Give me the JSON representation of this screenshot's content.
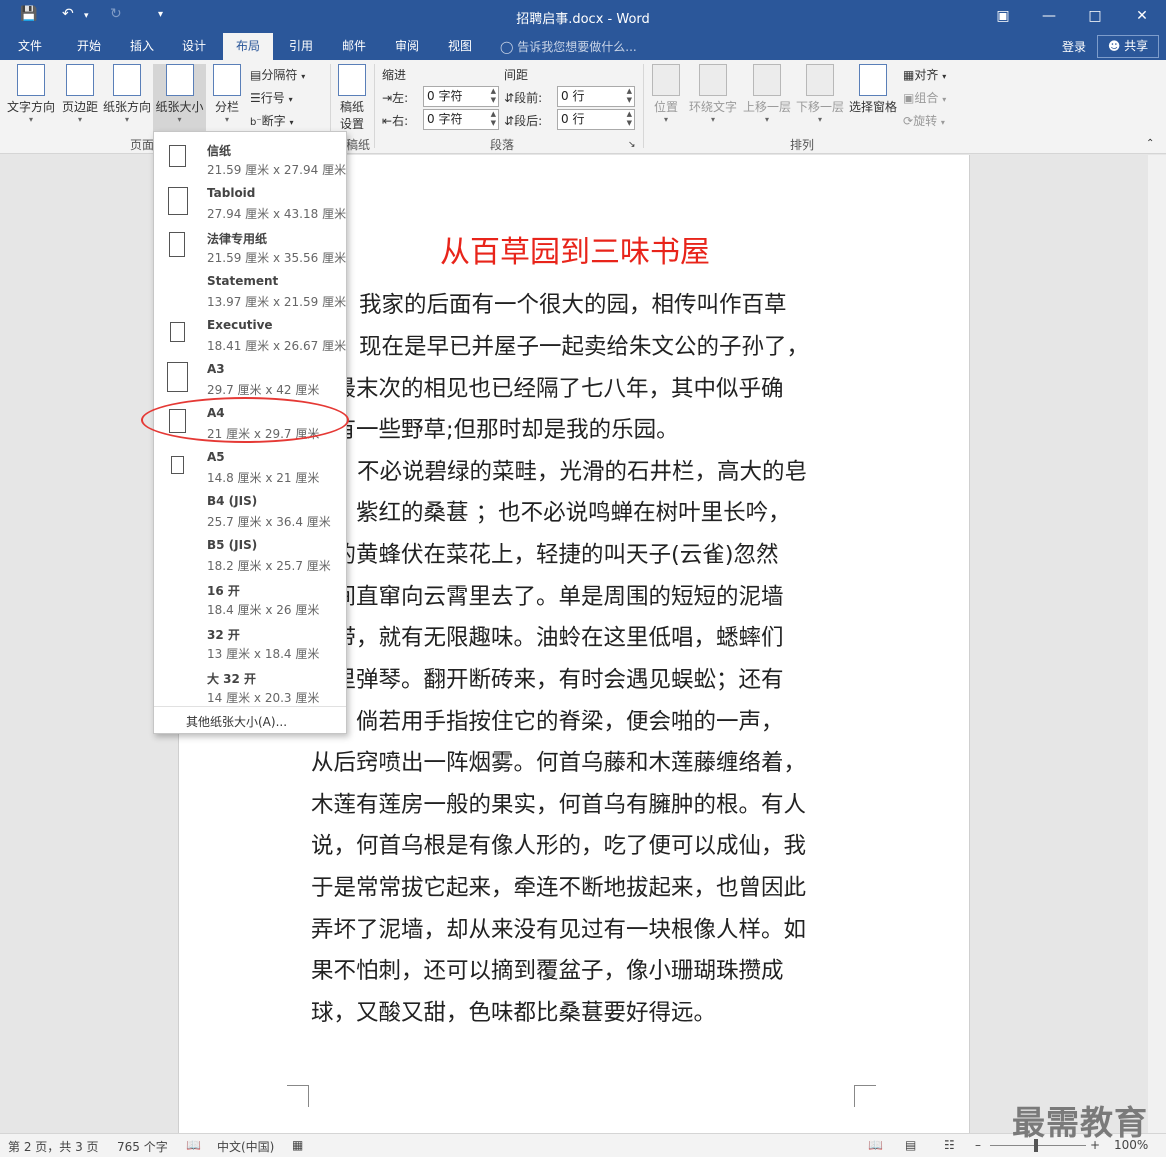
{
  "window": {
    "title": "招聘启事.docx - Word",
    "save_icon": "save-icon",
    "undo_icon": "undo-icon",
    "redo_icon": "redo-icon"
  },
  "tabs": [
    "文件",
    "开始",
    "插入",
    "设计",
    "布局",
    "引用",
    "邮件",
    "审阅",
    "视图"
  ],
  "active_tab": "布局",
  "tell_me": "告诉我您想要做什么...",
  "login": "登录",
  "share": "共享",
  "ribbon": {
    "page_setup": {
      "text_direction": "文字方向",
      "margins": "页边距",
      "orientation": "纸张方向",
      "size": "纸张大小",
      "columns": "分栏",
      "breaks": "分隔符",
      "line_numbers": "行号",
      "hyphenation": "断字",
      "group_label": "页面"
    },
    "draft": {
      "label_line1": "稿纸",
      "label_line2": "设置",
      "group_label": "稿纸"
    },
    "indent": {
      "title": "缩进",
      "left_label": "左:",
      "left_value": "0 字符",
      "right_label": "右:",
      "right_value": "0 字符"
    },
    "spacing": {
      "title": "间距",
      "before_label": "段前:",
      "before_value": "0 行",
      "after_label": "段后:",
      "after_value": "0 行"
    },
    "paragraph_group": "段落",
    "arrange": {
      "position": "位置",
      "wrap": "环绕文字",
      "forward": "上移一层",
      "backward": "下移一层",
      "selection_pane": "选择窗格",
      "align": "对齐",
      "group": "组合",
      "rotate": "旋转",
      "group_label": "排列"
    }
  },
  "paper_sizes": [
    {
      "name": "信纸",
      "dims": "21.59 厘米 x 27.94 厘米"
    },
    {
      "name": "Tabloid",
      "dims": "27.94 厘米 x 43.18 厘米"
    },
    {
      "name": "法律专用纸",
      "dims": "21.59 厘米 x 35.56 厘米"
    },
    {
      "name": "Statement",
      "dims": "13.97 厘米 x 21.59 厘米"
    },
    {
      "name": "Executive",
      "dims": "18.41 厘米 x 26.67 厘米"
    },
    {
      "name": "A3",
      "dims": "29.7 厘米 x 42 厘米"
    },
    {
      "name": "A4",
      "dims": "21 厘米 x 29.7 厘米"
    },
    {
      "name": "A5",
      "dims": "14.8 厘米 x 21 厘米"
    },
    {
      "name": "B4 (JIS)",
      "dims": "25.7 厘米 x 36.4 厘米"
    },
    {
      "name": "B5 (JIS)",
      "dims": "18.2 厘米 x 25.7 厘米"
    },
    {
      "name": "16 开",
      "dims": "18.4 厘米 x 26 厘米"
    },
    {
      "name": "32 开",
      "dims": "13 厘米 x 18.4 厘米"
    },
    {
      "name": "大 32 开",
      "dims": "14 厘米 x 20.3 厘米"
    }
  ],
  "more_sizes": "其他纸张大小(A)...",
  "document": {
    "title": "从百草园到三味书屋",
    "lines": [
      "我家的后面有一个很大的园，相传叫作百草",
      "现在是早已并屋子一起卖给朱文公的子孙了，",
      "那最末次的相见也已经隔了七八年，其中似乎确",
      "只有一些野草;但那时却是我的乐园。",
      "不必说碧绿的菜畦，光滑的石井栏，高大的皂",
      "树，紫红的桑葚 ；也不必说鸣蝉在树叶里长吟，",
      "胖的黄蜂伏在菜花上，轻捷的叫天子(云雀)忽然",
      "草间直窜向云霄里去了。单是周围的短短的泥墙",
      "一带，就有无限趣味。油蛉在这里低唱，蟋蟀们",
      "这里弹琴。翻开断砖来，有时会遇见蜈蚣；还有",
      "蝥，倘若用手指按住它的脊梁，便会啪的一声，",
      "从后窍喷出一阵烟雾。何首乌藤和木莲藤缠络着，",
      "木莲有莲房一般的果实，何首乌有臃肿的根。有人",
      "说，何首乌根是有像人形的，吃了便可以成仙，我",
      "于是常常拔它起来，牵连不断地拔起来，也曾因此",
      "弄坏了泥墙，却从来没有见过有一块根像人样。如",
      "果不怕刺，还可以摘到覆盆子，像小珊瑚珠攒成",
      "球，又酸又甜，色味都比桑葚要好得远。"
    ]
  },
  "status": {
    "page": "第 2 页，共 3 页",
    "words": "765 个字",
    "language": "中文(中国)",
    "zoom": "100%"
  },
  "watermark": "最需教育",
  "colors": {
    "brand": "#2b579a",
    "title_red": "#e8241a",
    "highlight": "#e53935"
  }
}
